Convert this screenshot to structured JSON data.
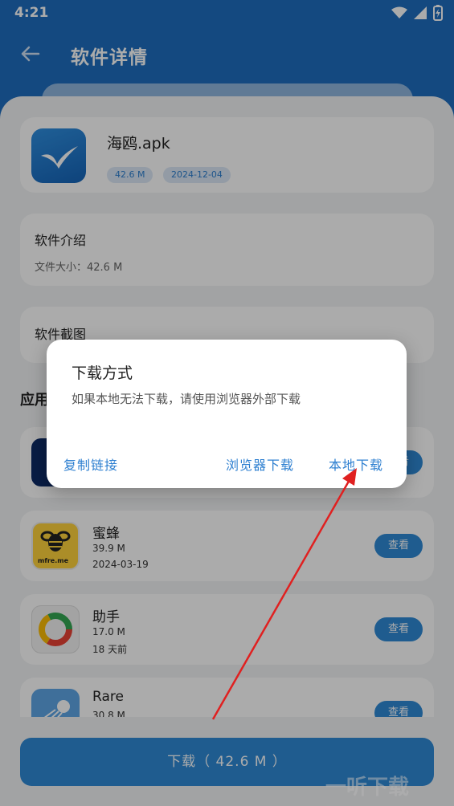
{
  "status": {
    "time": "4:21"
  },
  "header": {
    "title": "软件详情"
  },
  "app": {
    "name": "海鸥.apk",
    "size": "42.6 M",
    "date": "2024-12-04"
  },
  "intro": {
    "title": "软件介绍",
    "file_size": "文件大小：42.6 M"
  },
  "screenshots": {
    "title": "软件截图"
  },
  "related": {
    "title": "应用"
  },
  "list": [
    {
      "name": "蜜蜂",
      "size": "39.9 M",
      "date": "2024-03-19",
      "button": "查看",
      "icon_text": "mfre.me"
    },
    {
      "name": "助手",
      "size": "17.0 M",
      "date": "18 天前",
      "button": "查看"
    },
    {
      "name": "Rare",
      "size": "30.8 M",
      "date": "",
      "button": "查看"
    }
  ],
  "first_item_button": "查看",
  "download": {
    "label": "下载（ 42.6 M ）"
  },
  "dialog": {
    "title": "下载方式",
    "message": "如果本地无法下载，请使用浏览器外部下载",
    "copy_link": "复制链接",
    "browser_download": "浏览器下载",
    "local_download": "本地下载"
  },
  "watermark": "一听下载",
  "colors": {
    "primary": "#2f8ad6",
    "appbar": "#1f6ebf",
    "arrow": "#e02020"
  }
}
